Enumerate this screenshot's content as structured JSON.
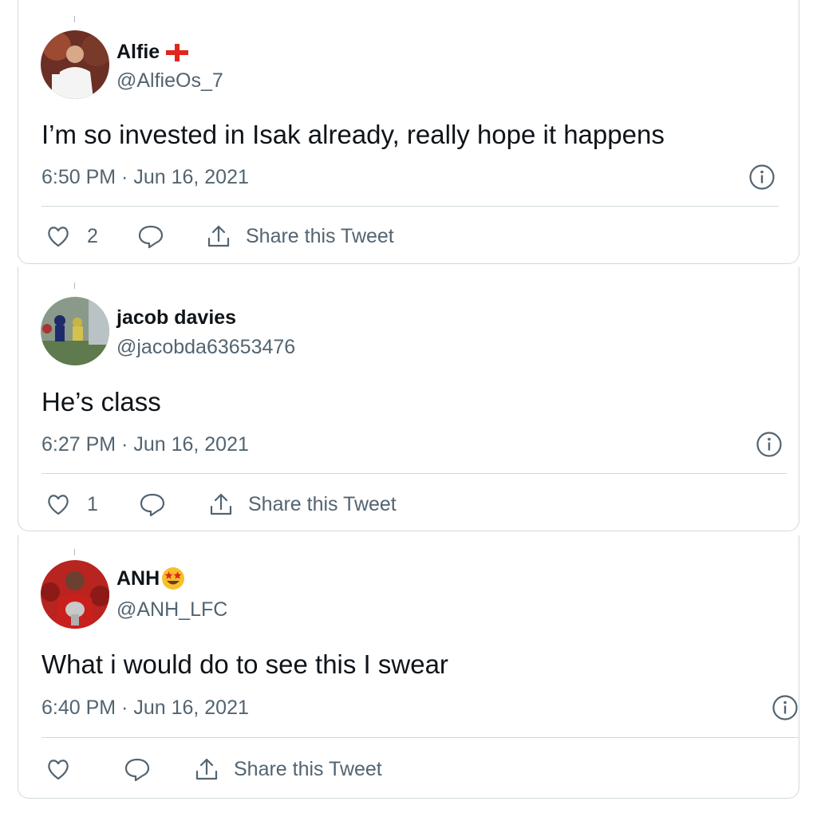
{
  "tweets": [
    {
      "name": "Alfie",
      "name_emoji": "england-flag-icon",
      "handle": "@AlfieOs_7",
      "text": "I’m so invested in Isak already, really hope it happens",
      "timestamp": "6:50 PM · Jun 16, 2021",
      "likes": "2",
      "share_label": "Share this Tweet"
    },
    {
      "name": "jacob davies",
      "handle": "@jacobda63653476",
      "text": "He’s class",
      "timestamp": "6:27 PM · Jun 16, 2021",
      "likes": "1",
      "share_label": "Share this Tweet"
    },
    {
      "name": "ANH",
      "name_emoji": "star-struck-emoji-icon",
      "handle": "@ANH_LFC",
      "text": "What i would do to see this I swear",
      "timestamp": "6:40 PM · Jun 16, 2021",
      "likes": "",
      "share_label": "Share this Tweet"
    }
  ],
  "colors": {
    "text_primary": "#0f1419",
    "text_secondary": "#536471",
    "border": "#cfd9de",
    "england_red": "#e1261c",
    "emoji_yellow": "#f7c02b"
  }
}
